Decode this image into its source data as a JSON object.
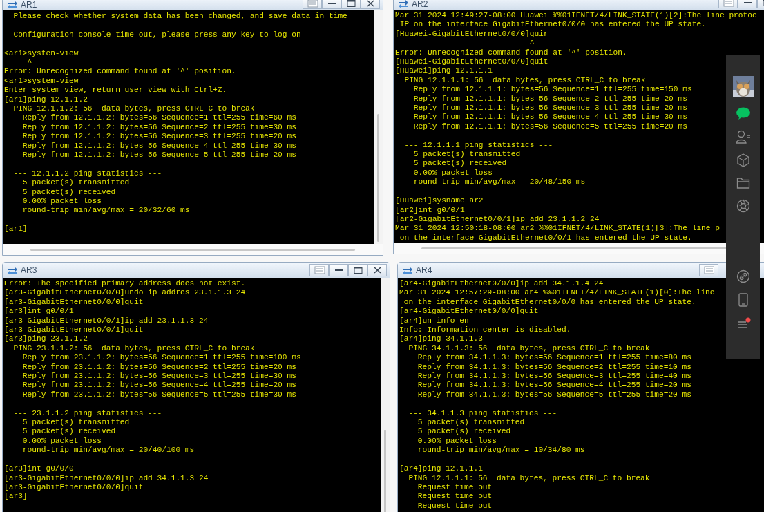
{
  "windows": [
    {
      "title": "AR1",
      "buttons": [
        {
          "kind": "tile"
        },
        {
          "kind": "minimize"
        },
        {
          "kind": "maximize"
        },
        {
          "kind": "close"
        }
      ],
      "blocks": [
        [
          "  Please check whether system data has been changed, and save data in time"
        ],
        [
          "  Configuration console time out, please press any key to log on"
        ],
        [
          "<ar1>systen-view",
          "     ^",
          "Error: Unrecognized command found at '^' position.",
          "<ar1>system-view",
          "Enter system view, return user view with Ctrl+Z.",
          "[ar1]ping 12.1.1.2",
          "  PING 12.1.1.2: 56  data bytes, press CTRL_C to break",
          "    Reply from 12.1.1.2: bytes=56 Sequence=1 ttl=255 time=60 ms",
          "    Reply from 12.1.1.2: bytes=56 Sequence=2 ttl=255 time=30 ms",
          "    Reply from 12.1.1.2: bytes=56 Sequence=3 ttl=255 time=20 ms",
          "    Reply from 12.1.1.2: bytes=56 Sequence=4 ttl=255 time=30 ms",
          "    Reply from 12.1.1.2: bytes=56 Sequence=5 ttl=255 time=20 ms"
        ],
        [
          "  --- 12.1.1.2 ping statistics ---",
          "    5 packet(s) transmitted",
          "    5 packet(s) received",
          "    0.00% packet loss",
          "    round-trip min/avg/max = 20/32/60 ms"
        ],
        [
          "[ar1]"
        ]
      ]
    },
    {
      "title": "AR2",
      "buttons": [
        {
          "kind": "tile"
        },
        {
          "kind": "minimize"
        },
        {
          "kind": "maximize"
        }
      ],
      "blocks": [
        [
          "Mar 31 2024 12:49:27-08:00 Huawei %%01IFNET/4/LINK_STATE(1)[2]:The line protoc",
          " IP on the interface GigabitEthernet0/0/0 has entered the UP state.",
          "[Huawei-GigabitEthernet0/0/0]quir",
          "                             ^",
          "Error: Unrecognized command found at '^' position.",
          "[Huawei-GigabitEthernet0/0/0]quit",
          "[Huawei]ping 12.1.1.1",
          "  PING 12.1.1.1: 56  data bytes, press CTRL_C to break",
          "    Reply from 12.1.1.1: bytes=56 Sequence=1 ttl=255 time=150 ms",
          "    Reply from 12.1.1.1: bytes=56 Sequence=2 ttl=255 time=20 ms",
          "    Reply from 12.1.1.1: bytes=56 Sequence=3 ttl=255 time=20 ms",
          "    Reply from 12.1.1.1: bytes=56 Sequence=4 ttl=255 time=30 ms",
          "    Reply from 12.1.1.1: bytes=56 Sequence=5 ttl=255 time=20 ms"
        ],
        [
          "  --- 12.1.1.1 ping statistics ---",
          "    5 packet(s) transmitted",
          "    5 packet(s) received",
          "    0.00% packet loss",
          "    round-trip min/avg/max = 20/48/150 ms"
        ],
        [
          "[Huawei]sysname ar2",
          "[ar2]int g0/0/1",
          "[ar2-GigabitEthernet0/0/1]ip add 23.1.1.2 24",
          "Mar 31 2024 12:50:18-08:00 ar2 %%01IFNET/4/LINK_STATE(1)[3]:The line p",
          " on the interface GigabitEthernet0/0/1 has entered the UP state."
        ]
      ]
    },
    {
      "title": "AR3",
      "buttons": [
        {
          "kind": "tile"
        },
        {
          "kind": "minimize"
        },
        {
          "kind": "maximize"
        },
        {
          "kind": "close"
        }
      ],
      "blocks": [
        [
          "Error: The specified primary address does not exist.",
          "[ar3-GigabitEthernet0/0/0]undo ip addres 23.1.1.3 24",
          "[ar3-GigabitEthernet0/0/0]quit",
          "[ar3]int g0/0/1",
          "[ar3-GigabitEthernet0/0/1]ip add 23.1.1.3 24",
          "[ar3-GigabitEthernet0/0/1]quit",
          "[ar3]ping 23.1.1.2",
          "  PING 23.1.1.2: 56  data bytes, press CTRL_C to break",
          "    Reply from 23.1.1.2: bytes=56 Sequence=1 ttl=255 time=100 ms",
          "    Reply from 23.1.1.2: bytes=56 Sequence=2 ttl=255 time=20 ms",
          "    Reply from 23.1.1.2: bytes=56 Sequence=3 ttl=255 time=30 ms",
          "    Reply from 23.1.1.2: bytes=56 Sequence=4 ttl=255 time=20 ms",
          "    Reply from 23.1.1.2: bytes=56 Sequence=5 ttl=255 time=30 ms"
        ],
        [
          "  --- 23.1.1.2 ping statistics ---",
          "    5 packet(s) transmitted",
          "    5 packet(s) received",
          "    0.00% packet loss",
          "    round-trip min/avg/max = 20/40/100 ms"
        ],
        [
          "[ar3]int g0/0/0",
          "[ar3-GigabitEthernet0/0/0]ip add 34.1.1.3 24",
          "[ar3-GigabitEthernet0/0/0]quit",
          "[ar3]"
        ]
      ]
    },
    {
      "title": "AR4",
      "buttons": [
        {
          "kind": "tile"
        }
      ],
      "blocks": [
        [
          "[ar4-GigabitEthernet0/0/0]ip add 34.1.1.4 24",
          "Mar 31 2024 12:57:29-08:00 ar4 %%01IFNET/4/LINK_STATE(1)[0]:The line",
          " on the interface GigabitEthernet0/0/0 has entered the UP state.",
          "[ar4-GigabitEthernet0/0/0]quit",
          "[ar4]un info en",
          "Info: Information center is disabled.",
          "[ar4]ping 34.1.1.3",
          "  PING 34.1.1.3: 56  data bytes, press CTRL_C to break",
          "    Reply from 34.1.1.3: bytes=56 Sequence=1 ttl=255 time=80 ms",
          "    Reply from 34.1.1.3: bytes=56 Sequence=2 ttl=255 time=10 ms",
          "    Reply from 34.1.1.3: bytes=56 Sequence=3 ttl=255 time=40 ms",
          "    Reply from 34.1.1.3: bytes=56 Sequence=4 ttl=255 time=20 ms",
          "    Reply from 34.1.1.3: bytes=56 Sequence=5 ttl=255 time=20 ms"
        ],
        [
          "  --- 34.1.1.3 ping statistics ---",
          "    5 packet(s) transmitted",
          "    5 packet(s) received",
          "    0.00% packet loss",
          "    round-trip min/avg/max = 10/34/80 ms"
        ],
        [
          "[ar4]ping 12.1.1.1",
          "  PING 12.1.1.1: 56  data bytes, press CTRL_C to break",
          "    Request time out",
          "    Request time out",
          "    Request time out"
        ]
      ]
    }
  ]
}
